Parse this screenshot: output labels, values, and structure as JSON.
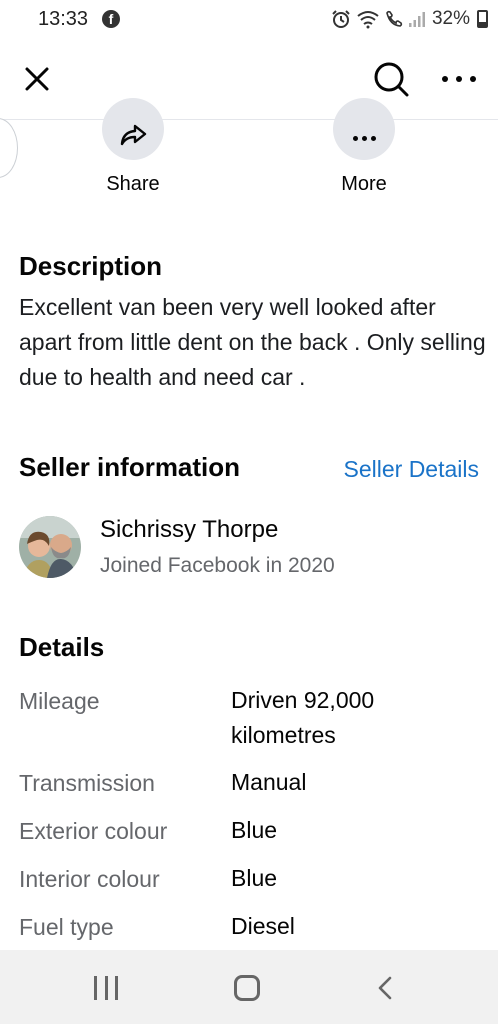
{
  "status_bar": {
    "time": "13:33",
    "battery": "32%"
  },
  "top_bar": {
    "close_icon": "close-icon",
    "search_icon": "search-icon",
    "menu_icon": "more-horizontal-icon"
  },
  "actions": {
    "share_label": "Share",
    "more_label": "More"
  },
  "description": {
    "title": "Description",
    "text": "Excellent van been very well looked after apart from little dent on the back . Only selling due to health and need car ."
  },
  "seller": {
    "title": "Seller information",
    "details_link": "Seller Details",
    "name": "Sichrissy Thorpe",
    "joined": "Joined Facebook in 2020"
  },
  "details": {
    "title": "Details",
    "rows": [
      {
        "label": "Mileage",
        "value": "Driven 92,000 kilometres"
      },
      {
        "label": "Transmission",
        "value": "Manual"
      },
      {
        "label": "Exterior colour",
        "value": "Blue"
      },
      {
        "label": "Interior colour",
        "value": "Blue"
      },
      {
        "label": "Fuel type",
        "value": "Diesel"
      }
    ]
  },
  "colors": {
    "link": "#1a73c8",
    "secondary_text": "#65676b",
    "button_bg": "#e4e6eb"
  }
}
